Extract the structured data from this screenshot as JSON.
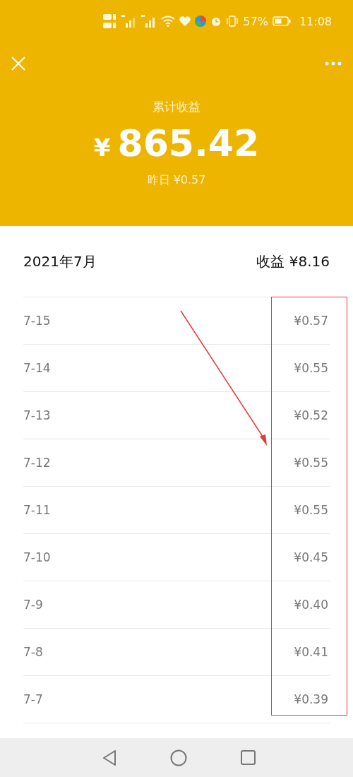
{
  "status_bar": {
    "battery": "57%",
    "time": "11:08"
  },
  "header": {
    "title": "累计收益",
    "currency": "¥",
    "total": "865.42",
    "yesterday": "昨日 ¥0.57"
  },
  "month": {
    "label": "2021年7月",
    "summary": "收益 ¥8.16"
  },
  "rows": [
    {
      "date": "7-15",
      "amount": "¥0.57"
    },
    {
      "date": "7-14",
      "amount": "¥0.55"
    },
    {
      "date": "7-13",
      "amount": "¥0.52"
    },
    {
      "date": "7-12",
      "amount": "¥0.55"
    },
    {
      "date": "7-11",
      "amount": "¥0.55"
    },
    {
      "date": "7-10",
      "amount": "¥0.45"
    },
    {
      "date": "7-9",
      "amount": "¥0.40"
    },
    {
      "date": "7-8",
      "amount": "¥0.41"
    },
    {
      "date": "7-7",
      "amount": "¥0.39"
    }
  ]
}
